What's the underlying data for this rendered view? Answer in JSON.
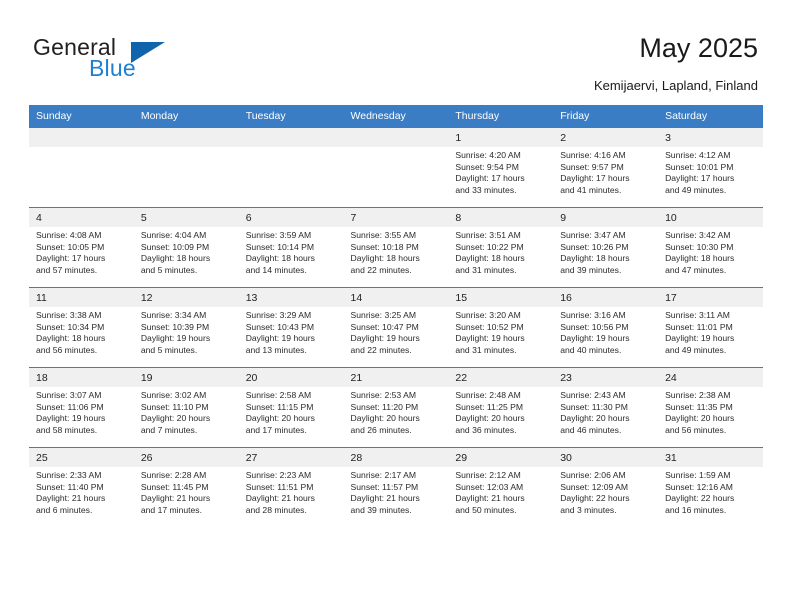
{
  "brand": {
    "word1": "General",
    "word2": "Blue",
    "logo_icon": "blue-triangle-logo",
    "accent_color": "#1064ab",
    "text_color": "#231f20"
  },
  "header": {
    "title": "May 2025",
    "subtitle": "Kemijaervi, Lapland, Finland"
  },
  "calendar": {
    "header_bg": "#3b7dc4",
    "daynum_bg": "#f0f0f0",
    "weekday_headers": [
      "Sunday",
      "Monday",
      "Tuesday",
      "Wednesday",
      "Thursday",
      "Friday",
      "Saturday"
    ],
    "weeks": [
      [
        {
          "day": "",
          "lines": []
        },
        {
          "day": "",
          "lines": []
        },
        {
          "day": "",
          "lines": []
        },
        {
          "day": "",
          "lines": []
        },
        {
          "day": "1",
          "lines": [
            "Sunrise: 4:20 AM",
            "Sunset: 9:54 PM",
            "Daylight: 17 hours",
            "and 33 minutes."
          ]
        },
        {
          "day": "2",
          "lines": [
            "Sunrise: 4:16 AM",
            "Sunset: 9:57 PM",
            "Daylight: 17 hours",
            "and 41 minutes."
          ]
        },
        {
          "day": "3",
          "lines": [
            "Sunrise: 4:12 AM",
            "Sunset: 10:01 PM",
            "Daylight: 17 hours",
            "and 49 minutes."
          ]
        }
      ],
      [
        {
          "day": "4",
          "lines": [
            "Sunrise: 4:08 AM",
            "Sunset: 10:05 PM",
            "Daylight: 17 hours",
            "and 57 minutes."
          ]
        },
        {
          "day": "5",
          "lines": [
            "Sunrise: 4:04 AM",
            "Sunset: 10:09 PM",
            "Daylight: 18 hours",
            "and 5 minutes."
          ]
        },
        {
          "day": "6",
          "lines": [
            "Sunrise: 3:59 AM",
            "Sunset: 10:14 PM",
            "Daylight: 18 hours",
            "and 14 minutes."
          ]
        },
        {
          "day": "7",
          "lines": [
            "Sunrise: 3:55 AM",
            "Sunset: 10:18 PM",
            "Daylight: 18 hours",
            "and 22 minutes."
          ]
        },
        {
          "day": "8",
          "lines": [
            "Sunrise: 3:51 AM",
            "Sunset: 10:22 PM",
            "Daylight: 18 hours",
            "and 31 minutes."
          ]
        },
        {
          "day": "9",
          "lines": [
            "Sunrise: 3:47 AM",
            "Sunset: 10:26 PM",
            "Daylight: 18 hours",
            "and 39 minutes."
          ]
        },
        {
          "day": "10",
          "lines": [
            "Sunrise: 3:42 AM",
            "Sunset: 10:30 PM",
            "Daylight: 18 hours",
            "and 47 minutes."
          ]
        }
      ],
      [
        {
          "day": "11",
          "lines": [
            "Sunrise: 3:38 AM",
            "Sunset: 10:34 PM",
            "Daylight: 18 hours",
            "and 56 minutes."
          ]
        },
        {
          "day": "12",
          "lines": [
            "Sunrise: 3:34 AM",
            "Sunset: 10:39 PM",
            "Daylight: 19 hours",
            "and 5 minutes."
          ]
        },
        {
          "day": "13",
          "lines": [
            "Sunrise: 3:29 AM",
            "Sunset: 10:43 PM",
            "Daylight: 19 hours",
            "and 13 minutes."
          ]
        },
        {
          "day": "14",
          "lines": [
            "Sunrise: 3:25 AM",
            "Sunset: 10:47 PM",
            "Daylight: 19 hours",
            "and 22 minutes."
          ]
        },
        {
          "day": "15",
          "lines": [
            "Sunrise: 3:20 AM",
            "Sunset: 10:52 PM",
            "Daylight: 19 hours",
            "and 31 minutes."
          ]
        },
        {
          "day": "16",
          "lines": [
            "Sunrise: 3:16 AM",
            "Sunset: 10:56 PM",
            "Daylight: 19 hours",
            "and 40 minutes."
          ]
        },
        {
          "day": "17",
          "lines": [
            "Sunrise: 3:11 AM",
            "Sunset: 11:01 PM",
            "Daylight: 19 hours",
            "and 49 minutes."
          ]
        }
      ],
      [
        {
          "day": "18",
          "lines": [
            "Sunrise: 3:07 AM",
            "Sunset: 11:06 PM",
            "Daylight: 19 hours",
            "and 58 minutes."
          ]
        },
        {
          "day": "19",
          "lines": [
            "Sunrise: 3:02 AM",
            "Sunset: 11:10 PM",
            "Daylight: 20 hours",
            "and 7 minutes."
          ]
        },
        {
          "day": "20",
          "lines": [
            "Sunrise: 2:58 AM",
            "Sunset: 11:15 PM",
            "Daylight: 20 hours",
            "and 17 minutes."
          ]
        },
        {
          "day": "21",
          "lines": [
            "Sunrise: 2:53 AM",
            "Sunset: 11:20 PM",
            "Daylight: 20 hours",
            "and 26 minutes."
          ]
        },
        {
          "day": "22",
          "lines": [
            "Sunrise: 2:48 AM",
            "Sunset: 11:25 PM",
            "Daylight: 20 hours",
            "and 36 minutes."
          ]
        },
        {
          "day": "23",
          "lines": [
            "Sunrise: 2:43 AM",
            "Sunset: 11:30 PM",
            "Daylight: 20 hours",
            "and 46 minutes."
          ]
        },
        {
          "day": "24",
          "lines": [
            "Sunrise: 2:38 AM",
            "Sunset: 11:35 PM",
            "Daylight: 20 hours",
            "and 56 minutes."
          ]
        }
      ],
      [
        {
          "day": "25",
          "lines": [
            "Sunrise: 2:33 AM",
            "Sunset: 11:40 PM",
            "Daylight: 21 hours",
            "and 6 minutes."
          ]
        },
        {
          "day": "26",
          "lines": [
            "Sunrise: 2:28 AM",
            "Sunset: 11:45 PM",
            "Daylight: 21 hours",
            "and 17 minutes."
          ]
        },
        {
          "day": "27",
          "lines": [
            "Sunrise: 2:23 AM",
            "Sunset: 11:51 PM",
            "Daylight: 21 hours",
            "and 28 minutes."
          ]
        },
        {
          "day": "28",
          "lines": [
            "Sunrise: 2:17 AM",
            "Sunset: 11:57 PM",
            "Daylight: 21 hours",
            "and 39 minutes."
          ]
        },
        {
          "day": "29",
          "lines": [
            "Sunrise: 2:12 AM",
            "Sunset: 12:03 AM",
            "Daylight: 21 hours",
            "and 50 minutes."
          ]
        },
        {
          "day": "30",
          "lines": [
            "Sunrise: 2:06 AM",
            "Sunset: 12:09 AM",
            "Daylight: 22 hours",
            "and 3 minutes."
          ]
        },
        {
          "day": "31",
          "lines": [
            "Sunrise: 1:59 AM",
            "Sunset: 12:16 AM",
            "Daylight: 22 hours",
            "and 16 minutes."
          ]
        }
      ]
    ]
  }
}
